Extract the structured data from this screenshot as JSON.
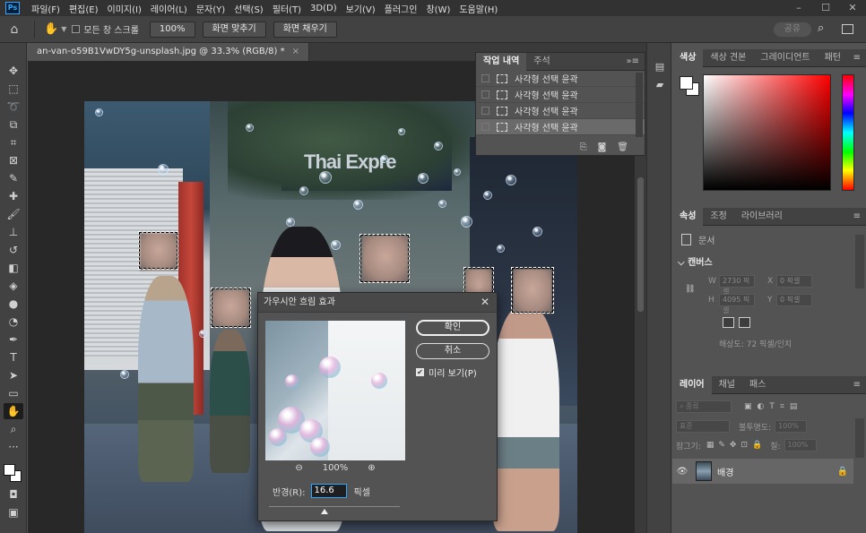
{
  "menubar": {
    "items": [
      "파일(F)",
      "편집(E)",
      "이미지(I)",
      "레이어(L)",
      "문자(Y)",
      "선택(S)",
      "필터(T)",
      "3D(D)",
      "보기(V)",
      "플러그인",
      "창(W)",
      "도움말(H)"
    ],
    "app_icon": "Ps"
  },
  "options": {
    "scroll_all_label": "모든 창 스크롤",
    "zoom_value": "100%",
    "fit_screen": "화면 맞추기",
    "fill_screen": "화면 채우기",
    "share": "공유"
  },
  "document": {
    "tab_title": "an-van-o59B1VwDY5g-unsplash.jpg @ 33.3% (RGB/8) *",
    "shop_text": "Thai Expre"
  },
  "history": {
    "tabs": [
      "작업 내역",
      "주석"
    ],
    "items": [
      "사각형 선택 윤곽",
      "사각형 선택 윤곽",
      "사각형 선택 윤곽",
      "사각형 선택 윤곽"
    ]
  },
  "blur_dialog": {
    "title": "가우시안 흐림 효과",
    "ok": "확인",
    "cancel": "취소",
    "preview_label": "미리 보기(P)",
    "zoom": "100%",
    "radius_label": "반경(R):",
    "radius_value": "16.6",
    "unit": "픽셀"
  },
  "color_panel": {
    "tabs": [
      "색상",
      "색상 견본",
      "그레이디언트",
      "패턴"
    ]
  },
  "properties": {
    "tabs": [
      "속성",
      "조정",
      "라이브러리"
    ],
    "doc_label": "문서",
    "canvas_label": "캔버스",
    "w_label": "W",
    "w_value": "2730 픽셀",
    "h_label": "H",
    "h_value": "4095 픽셀",
    "x_label": "X",
    "x_value": "0 픽셀",
    "y_label": "Y",
    "y_value": "0 픽셀",
    "resolution": "해상도: 72 픽셀/인치"
  },
  "layers": {
    "tabs": [
      "레이어",
      "채널",
      "패스"
    ],
    "kind_label": "종류",
    "blend_mode": "표준",
    "opacity_label": "불투명도:",
    "opacity_value": "100%",
    "lock_label": "잠그기:",
    "fill_label": "칠:",
    "fill_value": "100%",
    "layer_name": "배경"
  },
  "colors": {
    "accent": "#31a8ff",
    "panel": "#535353",
    "chrome": "#424242",
    "menubar": "#323232"
  }
}
